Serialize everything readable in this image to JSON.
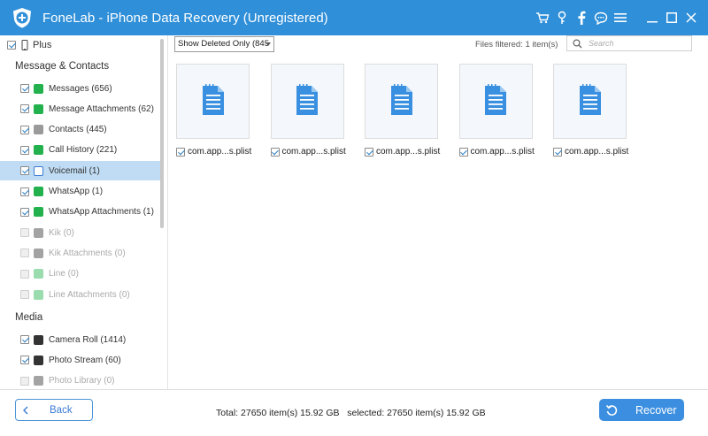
{
  "window": {
    "title": "FoneLab - iPhone Data Recovery (Unregistered)"
  },
  "titlebar_icons": [
    "cart-icon",
    "key-icon",
    "facebook-icon",
    "chat-icon",
    "menu-icon",
    "minimize-icon",
    "maximize-icon",
    "close-icon"
  ],
  "device": {
    "label": "Plus",
    "checked": true
  },
  "groups": {
    "messages": "Message & Contacts",
    "media": "Media"
  },
  "sidebar_items": [
    {
      "label": "Messages (656)",
      "icon": "messages-icon",
      "checked": true,
      "enabled": true,
      "selected": false
    },
    {
      "label": "Message Attachments (62)",
      "icon": "message-attachments-icon",
      "checked": true,
      "enabled": true,
      "selected": false
    },
    {
      "label": "Contacts (445)",
      "icon": "contacts-icon",
      "checked": true,
      "enabled": true,
      "selected": false
    },
    {
      "label": "Call History (221)",
      "icon": "phone-icon",
      "checked": true,
      "enabled": true,
      "selected": false
    },
    {
      "label": "Voicemail (1)",
      "icon": "voicemail-icon",
      "checked": true,
      "enabled": true,
      "selected": true
    },
    {
      "label": "WhatsApp (1)",
      "icon": "whatsapp-icon",
      "checked": true,
      "enabled": true,
      "selected": false
    },
    {
      "label": "WhatsApp Attachments (1)",
      "icon": "whatsapp-attachments-icon",
      "checked": true,
      "enabled": true,
      "selected": false
    },
    {
      "label": "Kik (0)",
      "icon": "kik-icon",
      "checked": false,
      "enabled": false,
      "selected": false
    },
    {
      "label": "Kik Attachments (0)",
      "icon": "kik-attachments-icon",
      "checked": false,
      "enabled": false,
      "selected": false
    },
    {
      "label": "Line (0)",
      "icon": "line-icon",
      "checked": false,
      "enabled": false,
      "selected": false
    },
    {
      "label": "Line Attachments (0)",
      "icon": "line-attachments-icon",
      "checked": false,
      "enabled": false,
      "selected": false
    }
  ],
  "media_items": [
    {
      "label": "Camera Roll (1414)",
      "icon": "camera-icon",
      "checked": true,
      "enabled": true
    },
    {
      "label": "Photo Stream (60)",
      "icon": "photo-stream-icon",
      "checked": true,
      "enabled": true
    },
    {
      "label": "Photo Library (0)",
      "icon": "photo-library-icon",
      "checked": false,
      "enabled": false
    }
  ],
  "toolbar": {
    "filter_value": "Show Deleted Only (845",
    "files_filtered": "Files filtered: 1 item(s)",
    "search_placeholder": "Search"
  },
  "files": [
    {
      "name": "com.app...s.plist",
      "checked": true
    },
    {
      "name": "com.app...s.plist",
      "checked": true
    },
    {
      "name": "com.app...s.plist",
      "checked": true
    },
    {
      "name": "com.app...s.plist",
      "checked": true
    },
    {
      "name": "com.app...s.plist",
      "checked": true
    }
  ],
  "footer": {
    "back_label": "Back",
    "totals": "Total: 27650 item(s) 15.92 GB   selected: 27650 item(s) 15.92 GB",
    "recover_label": "Recover"
  },
  "colors": {
    "accent": "#2f8fd8",
    "selected_row": "#bfdcf4",
    "button": "#3c8fe0"
  }
}
